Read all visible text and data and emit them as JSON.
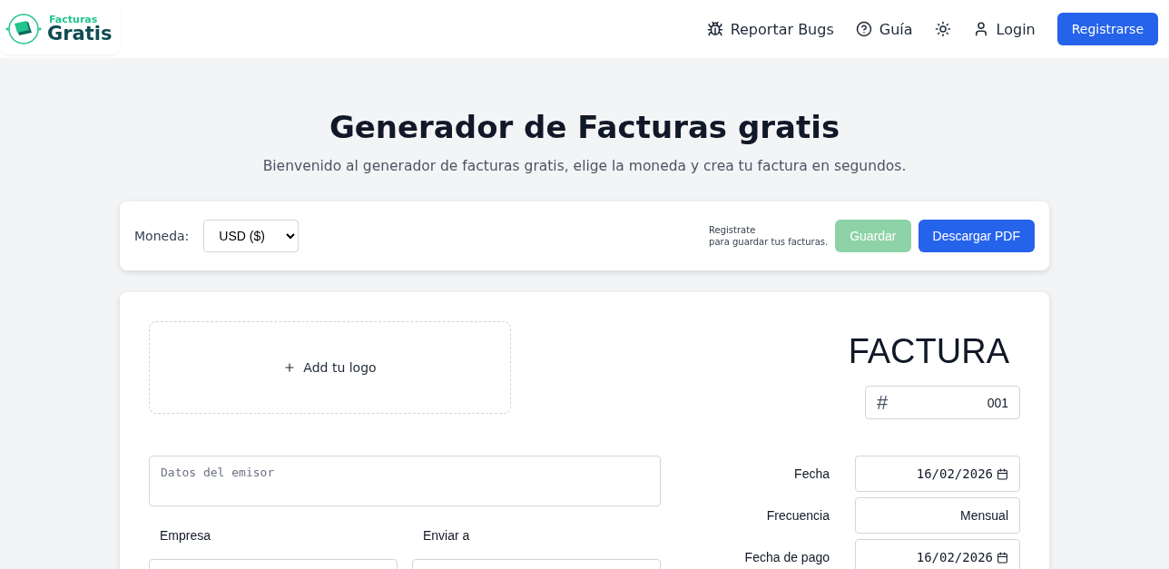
{
  "header": {
    "logo": {
      "top": "Facturas",
      "bottom": "Gratis"
    },
    "nav": [
      {
        "kind": "bug",
        "label": "Reportar Bugs"
      },
      {
        "kind": "help",
        "label": "Guía"
      },
      {
        "kind": "theme"
      },
      {
        "kind": "user",
        "label": "Login"
      }
    ],
    "cta": "Registrarse"
  },
  "hero": {
    "title": "Generador de Facturas gratis",
    "subtitle": "Bienvenido al generador de facturas gratis, elige la moneda y crea tu factura en segundos."
  },
  "toolbar": {
    "currency_label": "Moneda:",
    "currency": "USD ($)",
    "note": [
      "Registrate",
      "para guardar tus facturas."
    ],
    "save": {
      "label": "Guardar",
      "disabled": true
    },
    "download": "Descargar PDF"
  },
  "invoice": {
    "logo_drop": "Add tu logo",
    "heading": "FACTURA",
    "number_symbol": "#",
    "number": "001",
    "issuer_placeholder": "Datos del emisor",
    "parties": [
      "Empresa",
      "Enviar a"
    ],
    "meta": [
      {
        "kind": "date",
        "label": "Fecha",
        "value": "16/02/2026"
      },
      {
        "kind": "text",
        "label": "Frecuencia",
        "value": "Mensual"
      },
      {
        "kind": "date",
        "label": "Fecha de pago",
        "value": "16/02/2026"
      }
    ]
  }
}
